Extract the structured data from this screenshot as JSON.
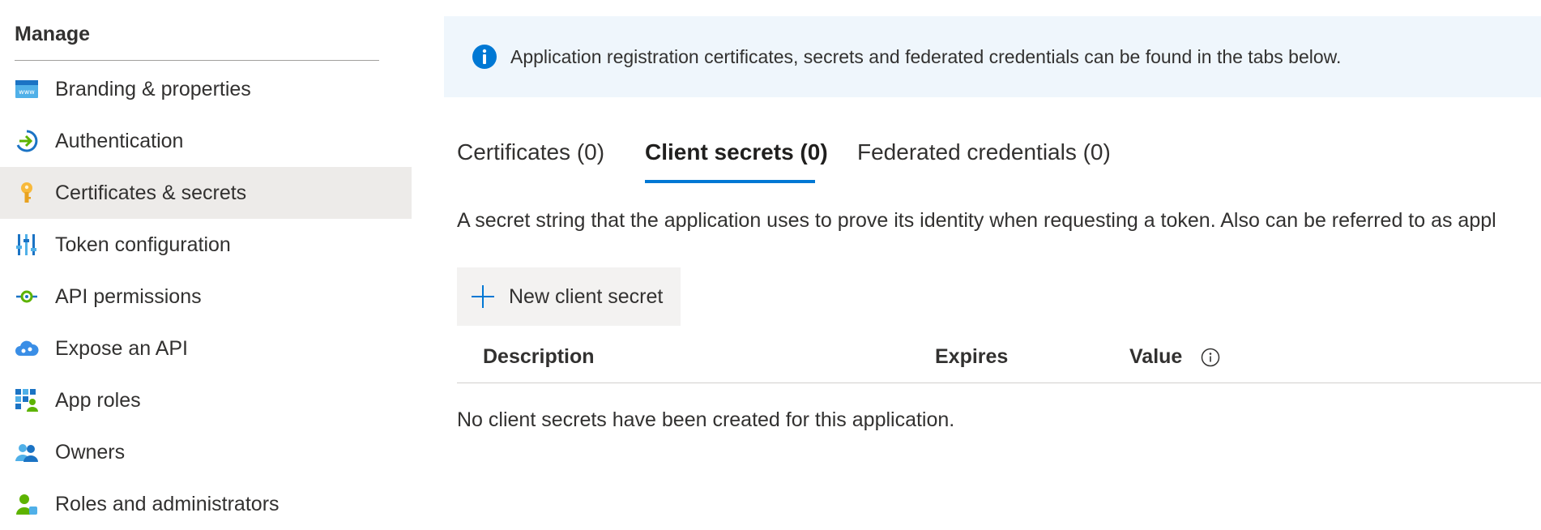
{
  "sidebar": {
    "section_title": "Manage",
    "items": [
      {
        "label": "Branding & properties",
        "icon": "branding-icon"
      },
      {
        "label": "Authentication",
        "icon": "authentication-icon"
      },
      {
        "label": "Certificates & secrets",
        "icon": "key-icon",
        "active": true
      },
      {
        "label": "Token configuration",
        "icon": "token-config-icon"
      },
      {
        "label": "API permissions",
        "icon": "api-permissions-icon"
      },
      {
        "label": "Expose an API",
        "icon": "cloud-api-icon"
      },
      {
        "label": "App roles",
        "icon": "app-roles-icon"
      },
      {
        "label": "Owners",
        "icon": "owners-icon"
      },
      {
        "label": "Roles and administrators",
        "icon": "roles-admin-icon"
      }
    ]
  },
  "banner": {
    "icon": "info-icon",
    "text": "Application registration certificates, secrets and federated credentials can be found in the tabs below."
  },
  "tabs": [
    {
      "label": "Certificates (0)"
    },
    {
      "label": "Client secrets (0)",
      "active": true
    },
    {
      "label": "Federated credentials (0)"
    }
  ],
  "description": "A secret string that the application uses to prove its identity when requesting a token. Also can be referred to as appl",
  "new_button": {
    "label": "New client secret",
    "icon": "plus-icon"
  },
  "table": {
    "columns": [
      "Description",
      "Expires",
      "Value"
    ],
    "value_info_icon": "info-circle-icon",
    "empty_message": "No client secrets have been created for this application."
  },
  "colors": {
    "accent": "#0078d4",
    "active_nav_bg": "#edebe9",
    "banner_bg": "#eff6fc",
    "button_bg": "#f3f2f1"
  }
}
